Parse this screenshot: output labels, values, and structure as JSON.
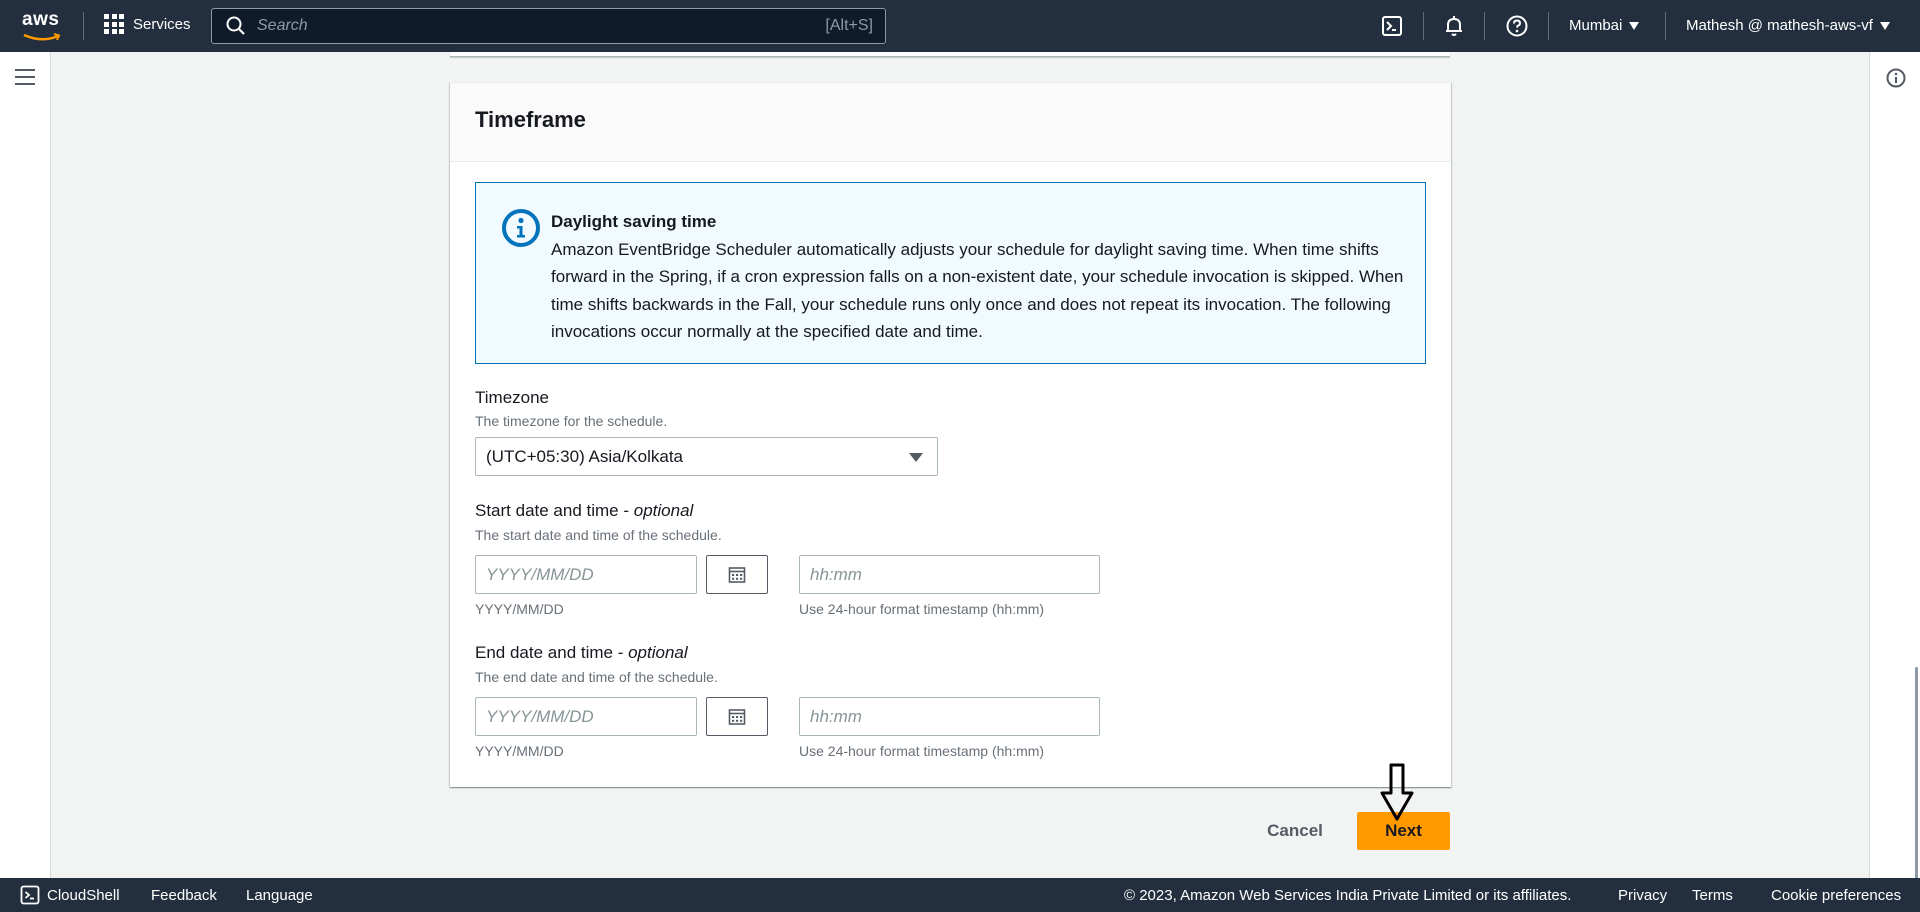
{
  "topnav": {
    "logo_text": "aws",
    "services_label": "Services",
    "search_placeholder": "Search",
    "search_shortcut": "[Alt+S]",
    "region": "Mumbai",
    "account": "Mathesh @ mathesh-aws-vf"
  },
  "panel": {
    "title": "Timeframe",
    "alert": {
      "title": "Daylight saving time",
      "body": "Amazon EventBridge Scheduler automatically adjusts your schedule for daylight saving time. When time shifts forward in the Spring, if a cron expression falls on a non-existent date, your schedule invocation is skipped. When time shifts backwards in the Fall, your schedule runs only once and does not repeat its invocation. The following invocations occur normally at the specified date and time."
    },
    "timezone": {
      "label": "Timezone",
      "description": "The timezone for the schedule.",
      "value": "(UTC+05:30) Asia/Kolkata"
    },
    "start": {
      "label": "Start date and time - ",
      "label_optional": "optional",
      "description": "The start date and time of the schedule.",
      "date_placeholder": "YYYY/MM/DD",
      "date_hint": "YYYY/MM/DD",
      "time_placeholder": "hh:mm",
      "time_hint": "Use 24-hour format timestamp (hh:mm)"
    },
    "end": {
      "label": "End date and time - ",
      "label_optional": "optional",
      "description": "The end date and time of the schedule.",
      "date_placeholder": "YYYY/MM/DD",
      "date_hint": "YYYY/MM/DD",
      "time_placeholder": "hh:mm",
      "time_hint": "Use 24-hour format timestamp (hh:mm)"
    }
  },
  "actions": {
    "cancel": "Cancel",
    "next": "Next"
  },
  "footer": {
    "cloudshell": "CloudShell",
    "feedback": "Feedback",
    "language": "Language",
    "copyright": "© 2023, Amazon Web Services India Private Limited or its affiliates.",
    "privacy": "Privacy",
    "terms": "Terms",
    "cookies": "Cookie preferences"
  },
  "colors": {
    "nav_bg": "#232f3e",
    "primary_button": "#ff9900",
    "info_border": "#0073bb",
    "info_bg": "#f1faff"
  }
}
